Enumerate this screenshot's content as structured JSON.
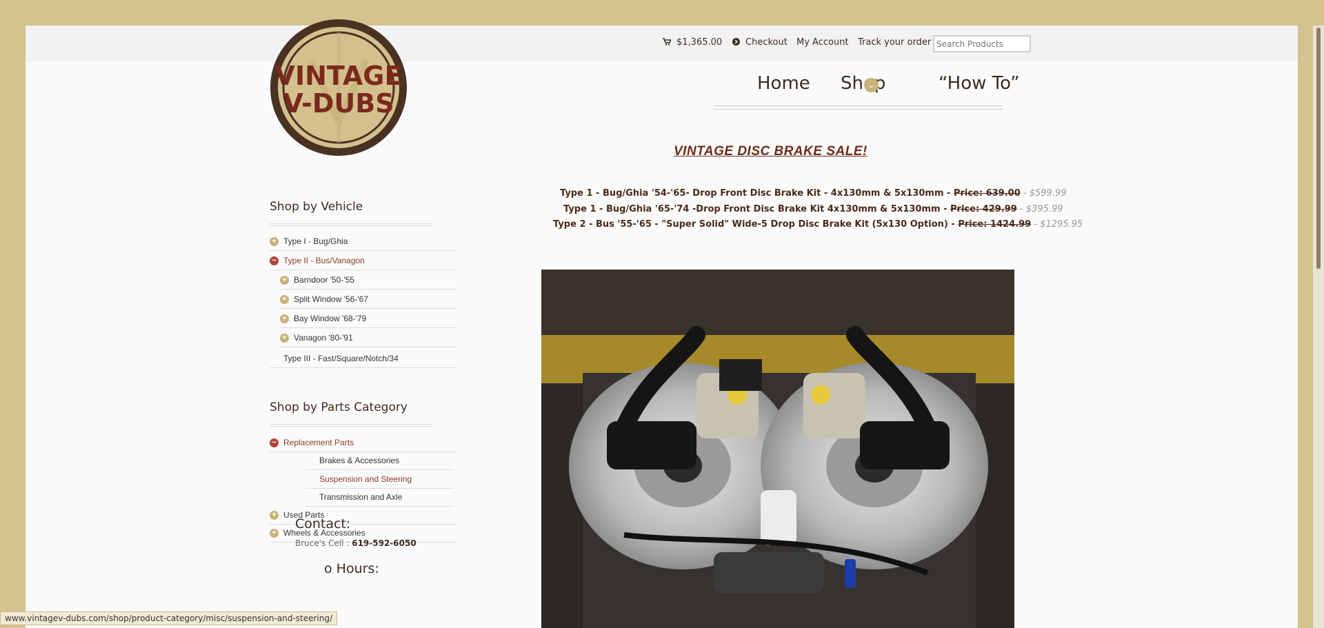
{
  "topbar": {
    "cart_total": "$1,365.00",
    "checkout": "Checkout",
    "my_account": "My Account",
    "track_order": "Track your order",
    "search_placeholder": "Search Products"
  },
  "logo": {
    "line1": "VINTAGE",
    "line2": "V-DUBS"
  },
  "mainnav": {
    "home": "Home",
    "shop": "Shop",
    "howto": "“How To”"
  },
  "sale": {
    "title": "VINTAGE DISC BRAKE SALE!",
    "items": [
      {
        "label": "Type 1 - Bug/Ghia '54-'65- Drop Front Disc Brake Kit - 4x130mm & 5x130mm - ",
        "old": "Price: 639.00",
        "sep": " - ",
        "new": "$599.99"
      },
      {
        "label": "Type 1 - Bug/Ghia '65-'74 -Drop Front Disc Brake Kit 4x130mm & 5x130mm - ",
        "old": "Price: 429.99",
        "sep": " - ",
        "new": "$395.99"
      },
      {
        "label": "Type 2 - Bus '55-'65 - \"Super Solid\" Wide-5 Drop Disc Brake Kit (5x130 Option) - ",
        "old": "Price: 1424.99",
        "sep": " - ",
        "new": "$1295.95"
      }
    ]
  },
  "sidebar": {
    "vehicle_title": "Shop by Vehicle",
    "vehicle_items": [
      {
        "label": "Type I - Bug/Ghia"
      },
      {
        "label": "Type II - Bus/Vanagon"
      },
      {
        "label": "Barndoor '50-'55"
      },
      {
        "label": "Split Window '56-'67"
      },
      {
        "label": "Bay Window '68-'79"
      },
      {
        "label": "Vanagon '80-'91"
      },
      {
        "label": "Type III - Fast/Square/Notch/34"
      }
    ],
    "parts_title": "Shop by Parts Category",
    "parts_items": [
      {
        "label": "Replacement Parts"
      },
      {
        "label": "Brakes & Accessories"
      },
      {
        "label": "Suspension and Steering"
      },
      {
        "label": "Transmission and Axle"
      },
      {
        "label": "Used Parts"
      },
      {
        "label": "Wheels & Accessories"
      }
    ]
  },
  "contact": {
    "title": "Contact:",
    "cell_label": "Bruce's Cell : ",
    "cell_number": "619-592-6050",
    "hours_title": "o Hours:"
  },
  "status_url": "www.vintagev-dubs.com/shop/product-category/misc/suspension-and-steering/",
  "colors": {
    "background": "#d4c28f",
    "accent": "#8c3b26",
    "brand_dark": "#3d2b20",
    "tan": "#c8b27a"
  }
}
